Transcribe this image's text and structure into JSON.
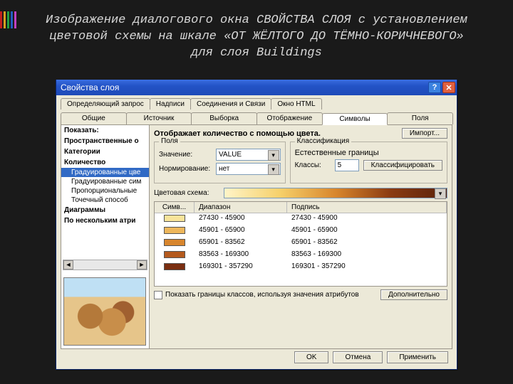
{
  "caption": "Изображение диалогового окна СВОЙСТВА СЛОЯ с установлением цветовой схемы на шкале «ОТ ЖЁЛТОГО ДО ТЁМНО-КОРИЧНЕВОГО» для слоя Buildings",
  "dialog": {
    "title": "Свойства слоя"
  },
  "tabs_row1": {
    "t0": "Определяющий запрос",
    "t1": "Надписи",
    "t2": "Соединения и Связи",
    "t3": "Окно HTML"
  },
  "tabs_row2": {
    "t0": "Общие",
    "t1": "Источник",
    "t2": "Выборка",
    "t3": "Отображение",
    "t4": "Символы",
    "t5": "Поля"
  },
  "left": {
    "show": "Показать:",
    "spatial": "Пространственные о",
    "categories": "Категории",
    "quantity": "Количество",
    "grad_colors": "Градуированные цве",
    "grad_symbols": "Градуированные сим",
    "proportional": "Пропорциональные",
    "dot": "Точечный способ",
    "diagrams": "Диаграммы",
    "multi": "По нескольким атри"
  },
  "right": {
    "desc": "Отображает количество с помощью цвета.",
    "import": "Импорт...",
    "fields_group": "Поля",
    "value_label": "Значение:",
    "value": "VALUE",
    "norm_label": "Нормирование:",
    "norm": "нет",
    "class_group": "Классификация",
    "natural": "Естественные границы",
    "classes_label": "Классы:",
    "classes": "5",
    "classify": "Классифицировать",
    "ramp_label": "Цветовая схема:"
  },
  "table": {
    "h_symbol": "Симв...",
    "h_range": "Диапазон",
    "h_label": "Подпись",
    "rows": [
      {
        "color": "#f8e49a",
        "range": "27430 - 45900",
        "label": "27430 - 45900"
      },
      {
        "color": "#eeb75c",
        "range": "45901 - 65900",
        "label": "45901 - 65900"
      },
      {
        "color": "#d8862e",
        "range": "65901 - 83562",
        "label": "65901 - 83562"
      },
      {
        "color": "#b45a1e",
        "range": "83563 - 169300",
        "label": "83563 - 169300"
      },
      {
        "color": "#7a2e10",
        "range": "169301 - 357290",
        "label": "169301 - 357290"
      }
    ]
  },
  "chk_label": "Показать границы классов, используя значения атрибутов",
  "adv_btn": "Дополнительно",
  "footer": {
    "ok": "OK",
    "cancel": "Отмена",
    "apply": "Применить"
  },
  "sidebar_colors": [
    "#c02020",
    "#d8a020",
    "#20a040",
    "#2060c0",
    "#c040c0"
  ]
}
